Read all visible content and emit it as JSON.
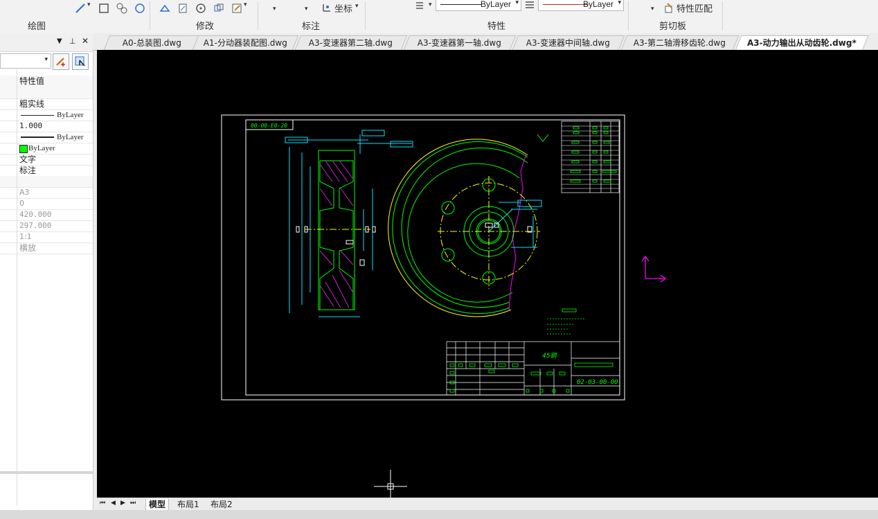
{
  "ribbon": {
    "groups": [
      {
        "label": "绘图"
      },
      {
        "label": "修改"
      },
      {
        "label": "标注"
      },
      {
        "label": "特性"
      },
      {
        "label": "剪切板"
      }
    ],
    "coord_label": "坐标",
    "match_props_label": "特性匹配",
    "linetype_combo": "ByLayer",
    "color_combo": "ByLayer",
    "accent_color": "#d02020"
  },
  "properties_panel": {
    "header_col": "特性值",
    "rows": [
      {
        "value": "粗实线"
      },
      {
        "value": "ByLayer",
        "kind": "line-thin"
      },
      {
        "value": "1.000"
      },
      {
        "value": "ByLayer",
        "kind": "line-thick"
      },
      {
        "value": "ByLayer",
        "kind": "color",
        "color": "#00ff00"
      },
      {
        "value": "文字"
      },
      {
        "value": "标注"
      }
    ],
    "layout_rows": [
      {
        "value": "A3"
      },
      {
        "value": "0"
      },
      {
        "value": "420.000"
      },
      {
        "value": "297.000"
      },
      {
        "value": "1:1"
      },
      {
        "value": "横放"
      }
    ]
  },
  "doc_tabs": [
    {
      "label": "A0-总装图.dwg"
    },
    {
      "label": "A1-分动器装配图.dwg"
    },
    {
      "label": "A3-变速器第二轴.dwg"
    },
    {
      "label": "A3-变速器第一轴.dwg"
    },
    {
      "label": "A3-变速器中间轴.dwg"
    },
    {
      "label": "A3-第二轴滑移齿轮.dwg"
    },
    {
      "label": "A3-动力输出从动齿轮.dwg*",
      "active": true
    }
  ],
  "layout_tabs": [
    {
      "label": "模型",
      "active": true
    },
    {
      "label": "布局1"
    },
    {
      "label": "布局2"
    }
  ],
  "drawing": {
    "title_block_material": "45钢",
    "title_block_number": "02-03-00-00",
    "border_code": "00-00-E0-20",
    "colors": {
      "cyan": "#00e5ff",
      "green": "#00ff00",
      "yellow": "#ffff00",
      "magenta": "#ff00ff",
      "white": "#ffffff",
      "red": "#ff3030"
    }
  }
}
